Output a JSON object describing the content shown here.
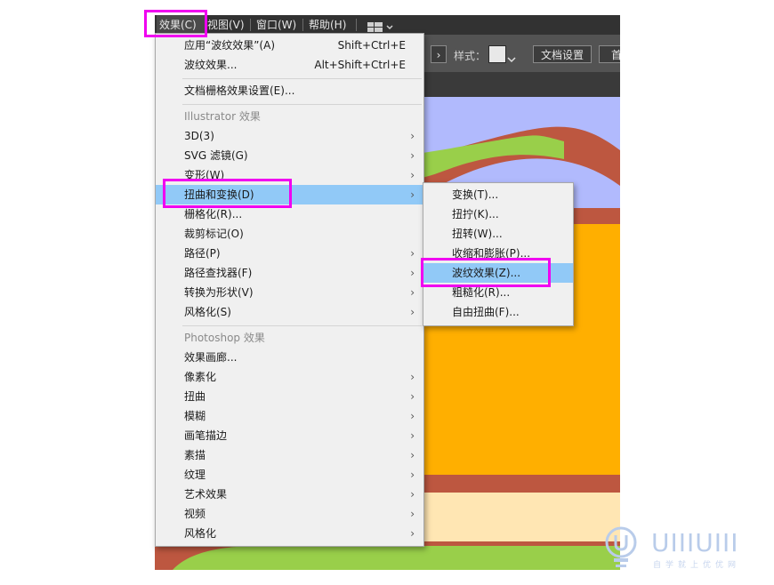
{
  "menubar": {
    "items": [
      "效果(C)",
      "视图(V)",
      "窗口(W)",
      "帮助(H)"
    ],
    "layout_icon": "workspace-layout-icon"
  },
  "controlbar": {
    "style_label": "样式：",
    "doc_settings": "文档设置",
    "first": "首"
  },
  "menu": {
    "apply_last": {
      "label": "应用“波纹效果”(A)",
      "shortcut": "Shift+Ctrl+E"
    },
    "last_effect": {
      "label": "波纹效果...",
      "shortcut": "Alt+Shift+Ctrl+E"
    },
    "raster_settings": "文档栅格效果设置(E)...",
    "illustrator_header": "Illustrator 效果",
    "illustrator_items": [
      "3D(3)",
      "SVG 滤镜(G)",
      "变形(W)",
      "扭曲和变换(D)",
      "栅格化(R)...",
      "裁剪标记(O)",
      "路径(P)",
      "路径查找器(F)",
      "转换为形状(V)",
      "风格化(S)"
    ],
    "photoshop_header": "Photoshop 效果",
    "photoshop_items": [
      "效果画廊...",
      "像素化",
      "扭曲",
      "模糊",
      "画笔描边",
      "素描",
      "纹理",
      "艺术效果",
      "视频",
      "风格化"
    ]
  },
  "submenu": {
    "items": [
      "变换(T)...",
      "扭拧(K)...",
      "扭转(W)...",
      "收缩和膨胀(P)...",
      "波纹效果(Z)...",
      "粗糙化(R)...",
      "自由扭曲(F)..."
    ]
  },
  "watermark": {
    "brand": "UIIIUIII",
    "tagline": "自学就上优优网"
  },
  "colors": {
    "highlight_box": "#f000f0",
    "menu_hover": "#91c9f7",
    "canvas_sky": "#b1bafd",
    "canvas_orange": "#ffaf00",
    "canvas_brown": "#bd5740",
    "canvas_green": "#99cf4a",
    "canvas_cream": "#ffe6b3"
  }
}
